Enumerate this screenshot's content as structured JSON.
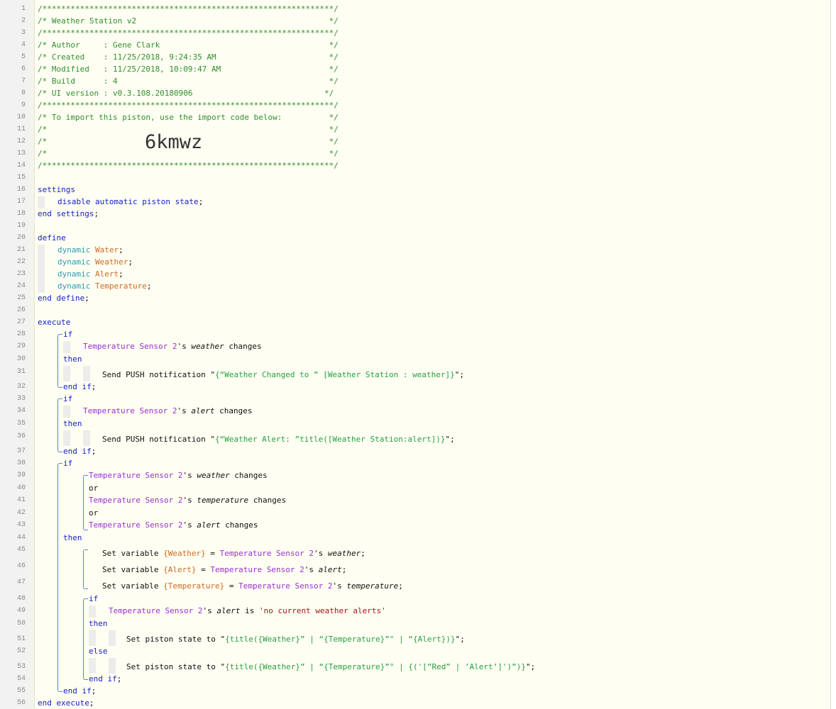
{
  "header": {
    "line1": "/**************************************************************/",
    "line2": "/* Weather Station v2                                         */",
    "line3": "/**************************************************************/",
    "line4": "/* Author     : Gene Clark                                    */",
    "line5": "/* Created    : 11/25/2018, 9:24:35 AM                        */",
    "line6": "/* Modified   : 11/25/2018, 10:09:47 AM                       */",
    "line7": "/* Build      : 4                                             */",
    "line8": "/* UI version : v0.3.108.20180906                            */",
    "line9": "/**************************************************************/",
    "line10": "/* To import this piston, use the import code below:          */",
    "line11": "/*                                                            */",
    "line12": "/*                                                            */",
    "line13": "/*                                                            */",
    "line14": "/**************************************************************/",
    "import_code": "6kmwz"
  },
  "settings": {
    "open": "settings",
    "item": "disable automatic piston state",
    "close": "end settings"
  },
  "define": {
    "open": "define",
    "keyword": "dynamic",
    "variables": [
      "Water",
      "Weather",
      "Alert",
      "Temperature"
    ],
    "close": "end define"
  },
  "execute": {
    "open": "execute",
    "close": "end execute",
    "kw_if": "if",
    "kw_then": "then",
    "kw_else": "else",
    "kw_or": "or",
    "kw_endif": "end if",
    "kw_is": "is",
    "device": "Temperature Sensor 2",
    "poss": "'s",
    "changes": "changes",
    "attr_weather": "weather",
    "attr_alert": "alert",
    "attr_temperature": "temperature",
    "push": "Send PUSH notification",
    "push1_str": "{“Weather Changed to ” [Weather Station : weather]}",
    "push2_str": "{“Weather Alert: ”title([Weather Station:alert])}",
    "set_var": "Set variable",
    "var_weather": "{Weather}",
    "var_alert": "{Alert}",
    "var_temperature": "{Temperature}",
    "no_alerts": "'no current weather alerts'",
    "set_state": "Set piston state to",
    "state1_str": "{title({Weather}” | “{Temperature}”° | “{Alert})}",
    "state2_str": "{title({Weather}” | “{Temperature}”° | {('[”Red” | ’Alert’]')”)}"
  },
  "line_numbers": [
    1,
    2,
    3,
    4,
    5,
    6,
    7,
    8,
    9,
    10,
    11,
    12,
    13,
    14,
    15,
    16,
    17,
    18,
    19,
    20,
    21,
    22,
    23,
    24,
    25,
    26,
    27,
    28,
    29,
    30,
    31,
    32,
    33,
    34,
    35,
    36,
    37,
    38,
    39,
    40,
    41,
    42,
    43,
    44,
    45,
    46,
    47,
    48,
    49,
    50,
    51,
    52,
    53,
    54,
    55,
    56
  ],
  "colors": {
    "comment": "#2f8f2f",
    "keyword": "#1420c8",
    "device": "#9a2fd6",
    "variable": "#d2691e",
    "string": "#26a042",
    "literal": "#a31515",
    "background": "#fefef2"
  }
}
